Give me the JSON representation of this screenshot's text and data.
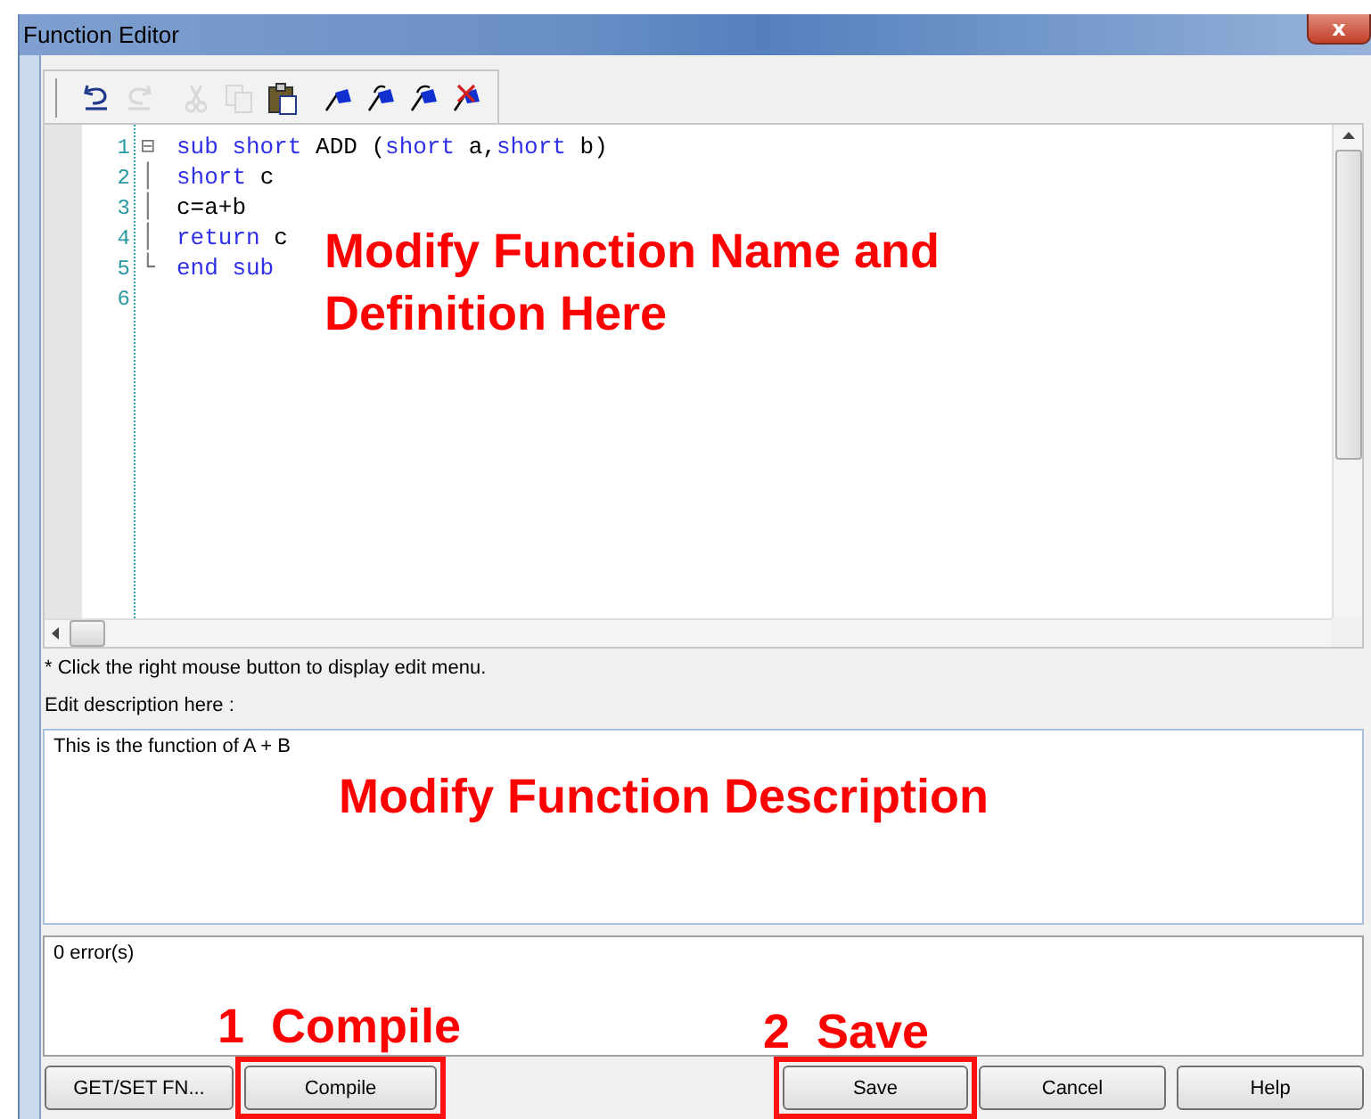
{
  "window": {
    "title": "Function Editor",
    "close_label": "x"
  },
  "toolbar": [
    {
      "kind": "undo",
      "disabled": false
    },
    {
      "kind": "redo",
      "disabled": true
    },
    {
      "kind": "cut",
      "disabled": true
    },
    {
      "kind": "copy",
      "disabled": true
    },
    {
      "kind": "paste",
      "disabled": false
    },
    {
      "kind": "flag",
      "disabled": false
    },
    {
      "kind": "flag-next",
      "disabled": false
    },
    {
      "kind": "flag-prev",
      "disabled": false
    },
    {
      "kind": "flag-clear",
      "disabled": false
    }
  ],
  "editor": {
    "lines": [
      {
        "number": "1",
        "fold": "⊟",
        "tokens": [
          {
            "text": "sub short",
            "kind": "keyword"
          },
          {
            "text": " ADD (",
            "kind": "plain"
          },
          {
            "text": "short",
            "kind": "keyword"
          },
          {
            "text": " a,",
            "kind": "plain"
          },
          {
            "text": "short",
            "kind": "keyword"
          },
          {
            "text": " b)",
            "kind": "plain"
          }
        ]
      },
      {
        "number": "2",
        "fold": "│",
        "tokens": [
          {
            "text": "short",
            "kind": "keyword"
          },
          {
            "text": " c",
            "kind": "plain"
          }
        ]
      },
      {
        "number": "3",
        "fold": "│",
        "tokens": [
          {
            "text": "c=a+b",
            "kind": "plain"
          }
        ]
      },
      {
        "number": "4",
        "fold": "│",
        "tokens": [
          {
            "text": "return",
            "kind": "keyword"
          },
          {
            "text": " c",
            "kind": "plain"
          }
        ]
      },
      {
        "number": "5",
        "fold": "└",
        "tokens": [
          {
            "text": "end sub",
            "kind": "keyword"
          }
        ]
      },
      {
        "number": "6"
      }
    ]
  },
  "note": "* Click the right mouse button to display edit menu.",
  "description": {
    "label": "Edit description here :",
    "value": "This is the function of A + B"
  },
  "errors": "0 error(s)",
  "buttons": [
    {
      "label": "GET/SET FN...",
      "highlighted": false
    },
    {
      "label": "Compile",
      "highlighted": true
    },
    {
      "label": "Save",
      "highlighted": true
    },
    {
      "label": "Cancel",
      "highlighted": false
    },
    {
      "label": "Help",
      "highlighted": false
    }
  ],
  "annotations": [
    "Modify Function Name and Definition Here",
    "Modify Function Description",
    "1  Compile",
    "2  Save"
  ]
}
